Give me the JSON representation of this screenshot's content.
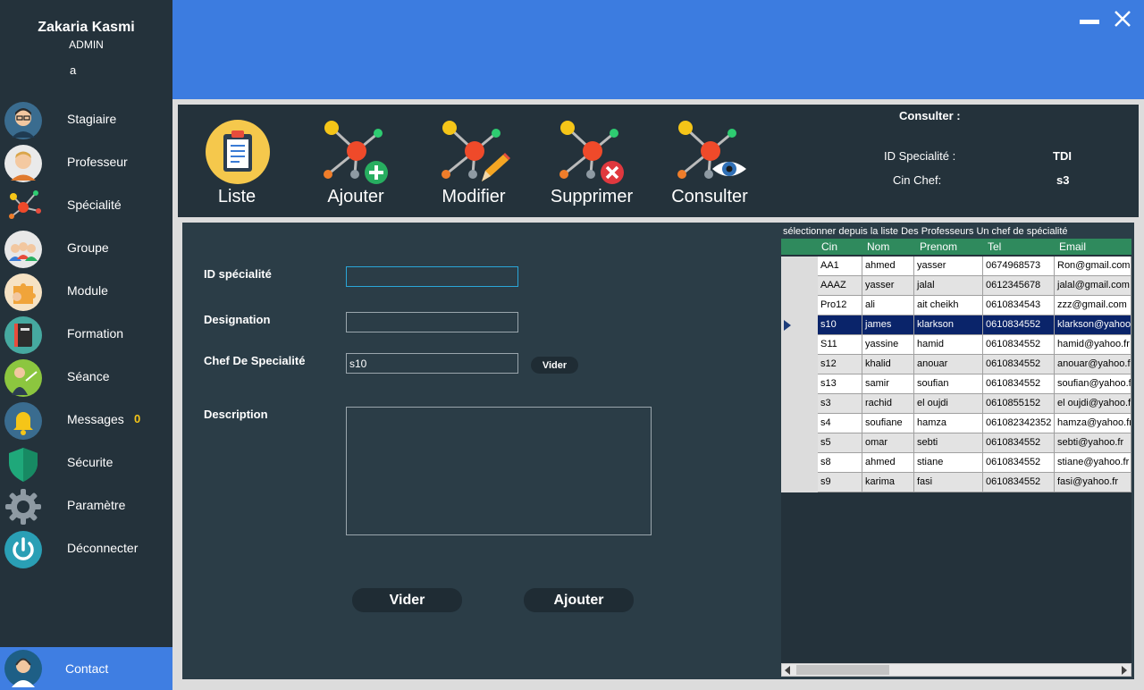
{
  "user": {
    "name": "Zakaria Kasmi",
    "role": "ADMIN",
    "extra": "a"
  },
  "sidebar": {
    "items": [
      {
        "label": "Stagiaire",
        "icon": "student-icon"
      },
      {
        "label": "Professeur",
        "icon": "professor-icon"
      },
      {
        "label": "Spécialité",
        "icon": "molecule-icon"
      },
      {
        "label": "Groupe",
        "icon": "group-icon"
      },
      {
        "label": "Module",
        "icon": "puzzle-icon"
      },
      {
        "label": "Formation",
        "icon": "book-icon"
      },
      {
        "label": "Séance",
        "icon": "teacher-board-icon"
      },
      {
        "label": "Messages",
        "icon": "bell-icon",
        "badge": "0"
      },
      {
        "label": "Sécurite",
        "icon": "shield-icon"
      },
      {
        "label": "Paramètre",
        "icon": "gear-icon"
      },
      {
        "label": "Déconnecter",
        "icon": "power-icon"
      }
    ],
    "contact": {
      "label": "Contact",
      "icon": "support-agent-icon"
    }
  },
  "toolbar": {
    "liste": "Liste",
    "ajouter": "Ajouter",
    "modifier": "Modifier",
    "supprimer": "Supprimer",
    "consulter": "Consulter"
  },
  "consult": {
    "title": "Consulter :",
    "id_label": "ID Specialité :",
    "id_value": "TDI",
    "cin_label": "Cin Chef:",
    "cin_value": "s3"
  },
  "form": {
    "id_label": "ID spécialité",
    "id_value": "",
    "designation_label": "Designation",
    "designation_value": "",
    "chef_label": "Chef De Specialité",
    "chef_value": "s10",
    "description_label": "Description",
    "description_value": "",
    "vider_small": "Vider",
    "vider": "Vider",
    "ajouter": "Ajouter"
  },
  "grid": {
    "caption": "sélectionner depuis la liste Des Professeurs Un chef de spécialité",
    "columns": [
      "Cin",
      "Nom",
      "Prenom",
      "Tel",
      "Email"
    ],
    "selected_index": 3,
    "rows": [
      [
        "AA1",
        "ahmed",
        "yasser",
        "0674968573",
        "Ron@gmail.com"
      ],
      [
        "AAAZ",
        "yasser",
        "jalal",
        "0612345678",
        "jalal@gmail.com"
      ],
      [
        "Pro12",
        "ali",
        "ait cheikh",
        "0610834543",
        "zzz@gmail.com"
      ],
      [
        "s10",
        "james",
        "klarkson",
        "0610834552",
        "klarkson@yahoo.fr"
      ],
      [
        "S11",
        "yassine",
        "hamid",
        "0610834552",
        "hamid@yahoo.fr"
      ],
      [
        "s12",
        "khalid",
        "anouar",
        "0610834552",
        "anouar@yahoo.fr"
      ],
      [
        "s13",
        "samir",
        "soufian",
        "0610834552",
        "soufian@yahoo.fr"
      ],
      [
        "s3",
        "rachid",
        "el oujdi",
        "0610855152",
        "el oujdi@yahoo.fr"
      ],
      [
        "s4",
        "soufiane",
        "hamza",
        "061082342352",
        "hamza@yahoo.fr"
      ],
      [
        "s5",
        "omar",
        "sebti",
        "0610834552",
        "sebti@yahoo.fr"
      ],
      [
        "s8",
        "ahmed",
        "stiane",
        "0610834552",
        "stiane@yahoo.fr"
      ],
      [
        "s9",
        "karima",
        "fasi",
        "0610834552",
        "fasi@yahoo.fr"
      ]
    ]
  },
  "colors": {
    "accent_blue": "#3c7ce0",
    "sidebar_bg": "#24323b",
    "panel_bg": "#2b3d47",
    "grid_header": "#2f8a5d",
    "grid_selected": "#0a246a",
    "badge": "#f5c518"
  }
}
